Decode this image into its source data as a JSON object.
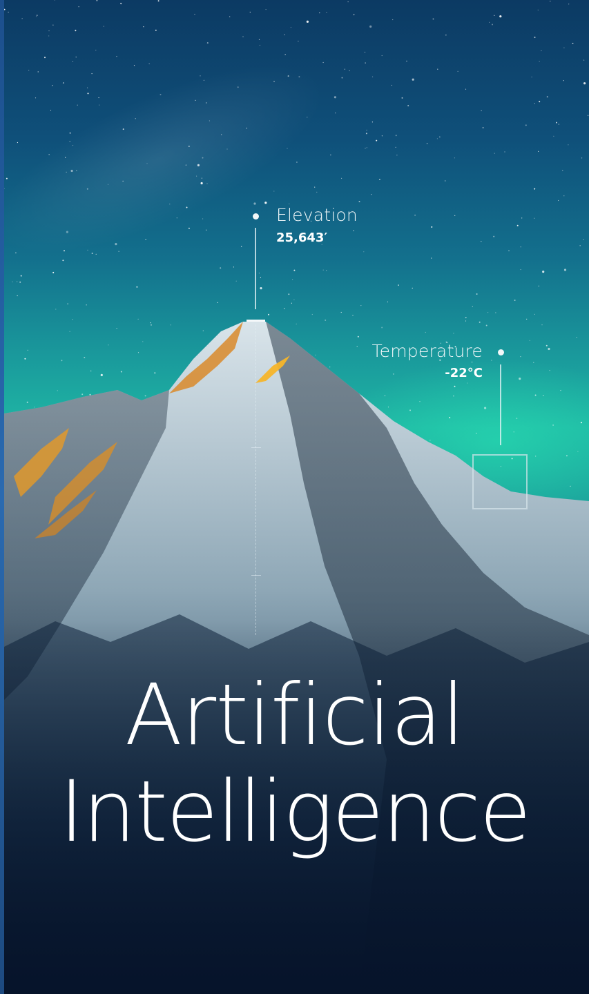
{
  "elevation": {
    "label": "Elevation",
    "value": "25,643′"
  },
  "temperature": {
    "label": "Temperature",
    "value": "-22°C"
  },
  "headline": {
    "line1": "Artificial",
    "line2": "Intelligence"
  },
  "colors": {
    "sky_top": "#0c3a63",
    "aurora": "#1fb6a4",
    "ground": "#06132a",
    "sunlit_peak": "#f0a020",
    "side_bar": "#2a6ab0",
    "text": "#ffffff"
  }
}
